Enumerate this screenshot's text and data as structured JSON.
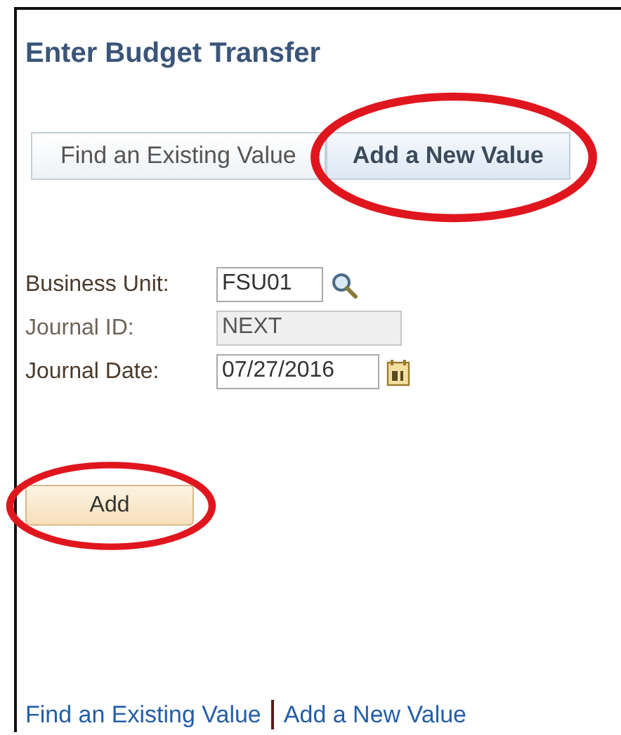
{
  "page": {
    "title": "Enter Budget Transfer"
  },
  "tabs": [
    {
      "label": "Find an Existing Value",
      "selected": false,
      "circled": false
    },
    {
      "label": "Add a New Value",
      "selected": true,
      "circled": true
    }
  ],
  "fields": [
    {
      "label": "Business Unit:",
      "value": "FSU01",
      "disabled": false,
      "kind": "lookup"
    },
    {
      "label": "Journal ID:",
      "value": "NEXT",
      "disabled": true,
      "kind": "text"
    },
    {
      "label": "Journal Date:",
      "value": "07/27/2016",
      "disabled": false,
      "kind": "date"
    }
  ],
  "add_button": {
    "label": "Add",
    "circled": true
  },
  "links": [
    "Find an Existing Value",
    "Add a New Value"
  ]
}
